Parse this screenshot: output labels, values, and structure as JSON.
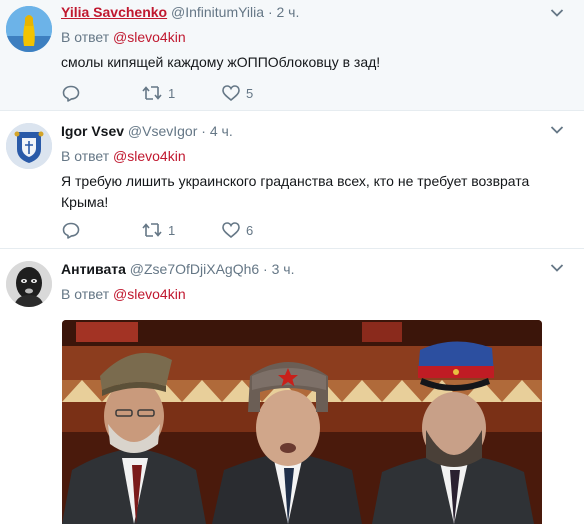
{
  "tweets": [
    {
      "name": "Yilia Savchenko",
      "handle": "@InfinitumYilia",
      "separator": "·",
      "time": "2 ч.",
      "reply_prefix": "В ответ",
      "reply_to": "@slevo4kin",
      "text": "смолы кипящей каждому жОППОблоковцу в зад!",
      "retweets": "1",
      "likes": "5"
    },
    {
      "name": "Igor Vsev",
      "handle": "@VsevIgor",
      "separator": "·",
      "time": "4 ч.",
      "reply_prefix": "В ответ",
      "reply_to": "@slevo4kin",
      "text_line1": "Я требую лишить украинского граданства всех, кто не требует возврата",
      "text_line2": "Крыма!",
      "retweets": "1",
      "likes": "6"
    },
    {
      "name": "Антивата",
      "handle": "@Zse7OfDjiXAgQh6",
      "separator": "·",
      "time": "3 ч.",
      "reply_prefix": "В ответ",
      "reply_to": "@slevo4kin"
    }
  ],
  "icons": {
    "reply": "reply-icon",
    "retweet": "retweet-icon",
    "like": "heart-icon",
    "menu": "chevron-down-icon"
  },
  "colors": {
    "accent": "#c0182f",
    "muted": "#657786",
    "divider": "#e6ecf0",
    "hover_bg": "#f5f8fa"
  }
}
